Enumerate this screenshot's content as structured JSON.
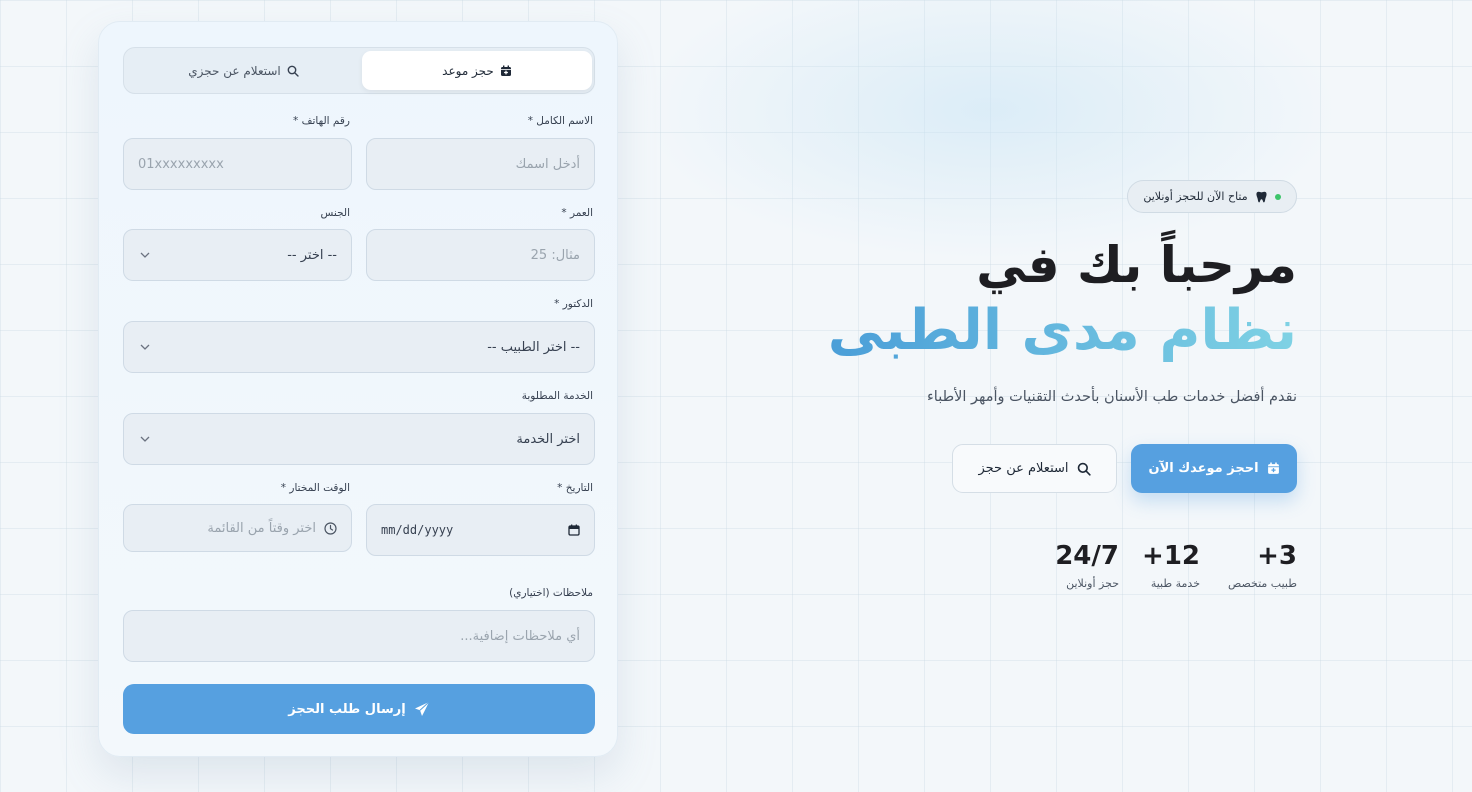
{
  "form": {
    "tabs": {
      "book": "حجز موعد",
      "inquiry": "استعلام عن حجزي"
    },
    "fields": {
      "name": {
        "label": "الاسم الكامل *",
        "placeholder": "أدخل اسمك"
      },
      "phone": {
        "label": "رقم الهاتف *",
        "placeholder": "01xxxxxxxxx"
      },
      "age": {
        "label": "العمر *",
        "placeholder": "مثال: 25"
      },
      "gender": {
        "label": "الجنس",
        "value": "-- اختر --"
      },
      "doctor": {
        "label": "الدكتور *",
        "value": "-- اختر الطبيب --"
      },
      "service": {
        "label": "الخدمة المطلوبة",
        "value": "اختر الخدمة"
      },
      "date": {
        "label": "التاريخ *",
        "value": "mm/dd/yyyy"
      },
      "time": {
        "label": "الوقت المختار *",
        "placeholder": "اختر وقتاً من القائمة"
      },
      "notes": {
        "label": "ملاحظات (اختياري)",
        "placeholder": "أي ملاحظات إضافية..."
      }
    },
    "submit_label": "إرسال طلب الحجز"
  },
  "hero": {
    "badge": "متاح الآن للحجز أونلاين",
    "title_line1": "مرحباً بك في",
    "title_line2": "نظام مدى الطبى",
    "subtitle": "نقدم أفضل خدمات طب الأسنان بأحدث التقنيات وأمهر الأطباء",
    "primary_button": "احجز موعدك الآن",
    "secondary_button": "استعلام عن حجز",
    "stats": [
      {
        "value": "+3",
        "label": "طبيب متخصص"
      },
      {
        "value": "+12",
        "label": "خدمة طبية"
      },
      {
        "value": "24/7",
        "label": "حجز أونلاين"
      }
    ]
  },
  "colors": {
    "accent": "#56a0e0",
    "accent_light": "#7fd2e4",
    "online_dot": "#3cc46a"
  }
}
